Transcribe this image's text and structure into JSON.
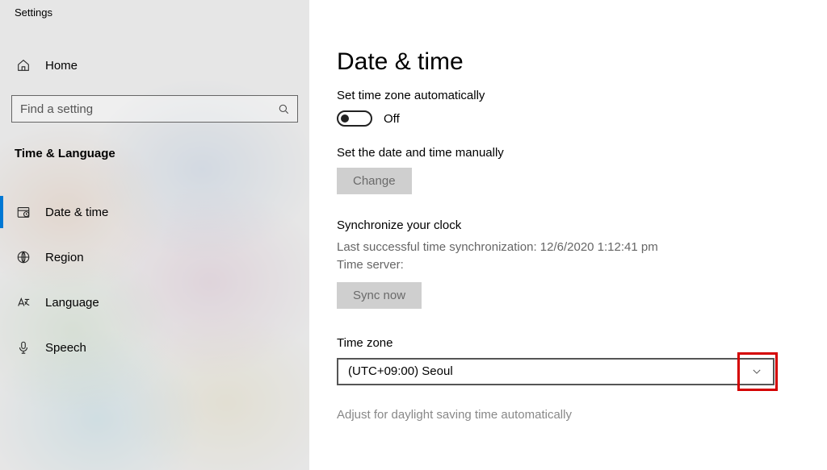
{
  "sidebar": {
    "title": "Settings",
    "home_label": "Home",
    "search_placeholder": "Find a setting",
    "category": "Time & Language",
    "items": [
      {
        "label": "Date & time"
      },
      {
        "label": "Region"
      },
      {
        "label": "Language"
      },
      {
        "label": "Speech"
      }
    ]
  },
  "main": {
    "title": "Date & time",
    "auto_tz_label": "Set time zone automatically",
    "auto_tz_state": "Off",
    "manual_label": "Set the date and time manually",
    "change_btn": "Change",
    "sync_heading": "Synchronize your clock",
    "last_sync": "Last successful time synchronization: 12/6/2020 1:12:41 pm",
    "time_server": "Time server:",
    "sync_btn": "Sync now",
    "tz_label": "Time zone",
    "tz_value": "(UTC+09:00) Seoul",
    "dst_label": "Adjust for daylight saving time automatically"
  }
}
